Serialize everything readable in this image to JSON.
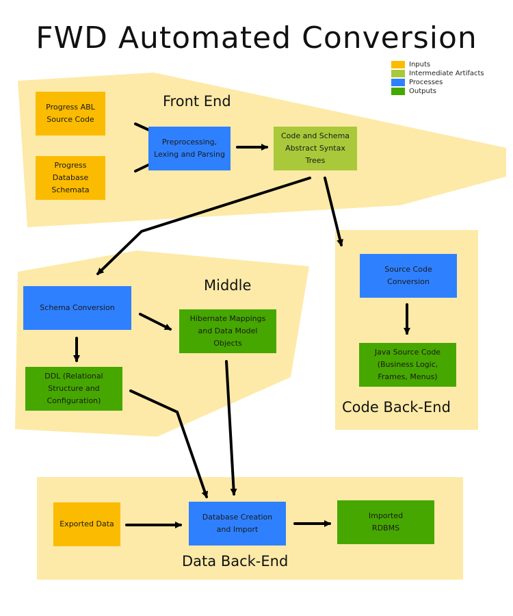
{
  "title": "FWD Automated Conversion",
  "colors": {
    "region": "#fdeaa8",
    "input": "#fbbb00",
    "intermediate": "#a9c93a",
    "process": "#2f80ff",
    "output": "#46a700",
    "arrow": "#000000"
  },
  "legend": [
    {
      "label": "Inputs",
      "type": "input"
    },
    {
      "label": "Intermediate Artifacts",
      "type": "intermediate"
    },
    {
      "label": "Processes",
      "type": "process"
    },
    {
      "label": "Outputs",
      "type": "output"
    }
  ],
  "regions": {
    "front_end": "Front End",
    "middle": "Middle",
    "code_back_end": "Code Back-End",
    "data_back_end": "Data Back-End"
  },
  "nodes": {
    "abl_source": {
      "label": "Progress ABL\nSource Code",
      "type": "input"
    },
    "db_schemata": {
      "label": "Progress\nDatabase\nSchemata",
      "type": "input"
    },
    "preprocessing": {
      "label": "Preprocessing,\nLexing and Parsing",
      "type": "process"
    },
    "ast": {
      "label": "Code and Schema\nAbstract Syntax\nTrees",
      "type": "intermediate"
    },
    "schema_conversion": {
      "label": "Schema Conversion",
      "type": "process"
    },
    "hibernate": {
      "label": "Hibernate Mappings\nand Data Model\nObjects",
      "type": "output"
    },
    "ddl": {
      "label": "DDL (Relational\nStructure and\nConfiguration)",
      "type": "output"
    },
    "source_conversion": {
      "label": "Source Code\nConversion",
      "type": "process"
    },
    "java_source": {
      "label": "Java Source Code\n(Business Logic,\nFrames, Menus)",
      "type": "output"
    },
    "exported_data": {
      "label": "Exported Data",
      "type": "input"
    },
    "db_creation": {
      "label": "Database Creation\nand Import",
      "type": "process"
    },
    "imported_rdbms": {
      "label": "Imported\nRDBMS",
      "type": "output"
    }
  },
  "edges": [
    {
      "from": "abl_source",
      "to": "preprocessing"
    },
    {
      "from": "db_schemata",
      "to": "preprocessing"
    },
    {
      "from": "preprocessing",
      "to": "ast"
    },
    {
      "from": "ast",
      "to": "schema_conversion"
    },
    {
      "from": "ast",
      "to": "source_conversion"
    },
    {
      "from": "schema_conversion",
      "to": "hibernate"
    },
    {
      "from": "schema_conversion",
      "to": "ddl"
    },
    {
      "from": "source_conversion",
      "to": "java_source"
    },
    {
      "from": "ddl",
      "to": "db_creation"
    },
    {
      "from": "hibernate",
      "to": "db_creation"
    },
    {
      "from": "exported_data",
      "to": "db_creation"
    },
    {
      "from": "db_creation",
      "to": "imported_rdbms"
    }
  ]
}
